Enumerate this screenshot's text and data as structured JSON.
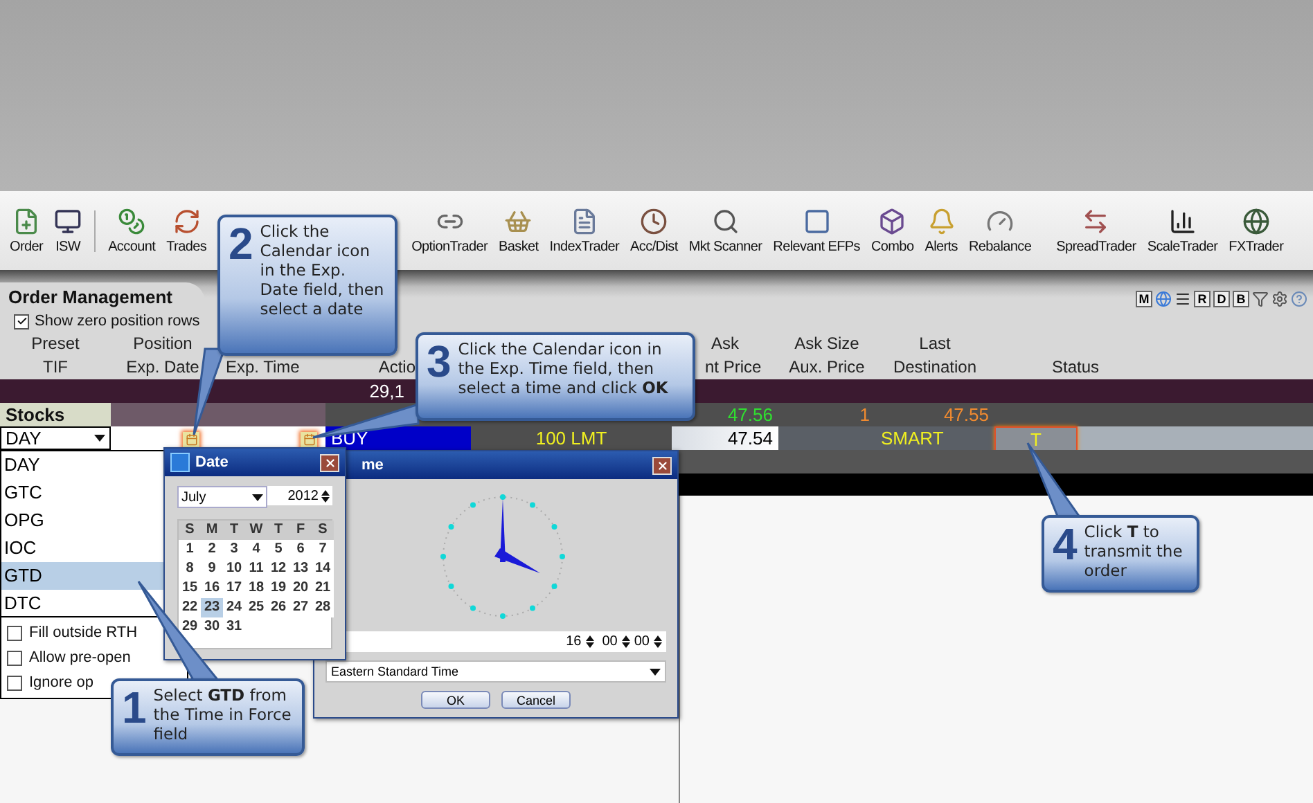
{
  "toolbar": {
    "items": [
      {
        "label": "Order"
      },
      {
        "label": "ISW"
      },
      {
        "label": "Account"
      },
      {
        "label": "Trades"
      },
      {
        "label": "OptionTrader"
      },
      {
        "label": "Basket"
      },
      {
        "label": "IndexTrader"
      },
      {
        "label": "Acc/Dist"
      },
      {
        "label": "Mkt Scanner"
      },
      {
        "label": "Relevant EFPs"
      },
      {
        "label": "Combo"
      },
      {
        "label": "Alerts"
      },
      {
        "label": "Rebalance"
      },
      {
        "label": "SpreadTrader"
      },
      {
        "label": "ScaleTrader"
      },
      {
        "label": "FXTrader"
      }
    ]
  },
  "panel": {
    "title": "Order Management",
    "view_buttons": [
      "M",
      "R",
      "D",
      "B"
    ],
    "show_zero": {
      "label": "Show zero position rows",
      "checked": true
    }
  },
  "table": {
    "header_top": [
      "Preset",
      "Position",
      "Ask",
      "Ask Size",
      "Last"
    ],
    "header_bottom": [
      "TIF",
      "Exp. Date",
      "Exp. Time",
      "Actio",
      "nt Price",
      "Aux. Price",
      "Destination",
      "Status"
    ],
    "summary_value": "29,1",
    "group": {
      "label": "Stocks",
      "ask": "47.56",
      "ask_size": "1",
      "last": "47.55"
    },
    "order": {
      "tif": "DAY",
      "action": "BUY",
      "quantity": "100 LMT",
      "limit_price": "47.54",
      "destination": "SMART",
      "status": "T"
    }
  },
  "tif_dropdown": {
    "options": [
      {
        "label": "DAY",
        "selected": false
      },
      {
        "label": "GTC",
        "selected": false
      },
      {
        "label": "OPG",
        "selected": false
      },
      {
        "label": "IOC",
        "selected": false
      },
      {
        "label": "GTD",
        "selected": true
      },
      {
        "label": "DTC",
        "selected": false
      }
    ],
    "checkboxes": [
      {
        "label": "Fill outside RTH",
        "checked": false
      },
      {
        "label": "Allow pre-open",
        "checked": false
      },
      {
        "label": "Ignore op",
        "checked": false
      }
    ]
  },
  "date_dialog": {
    "title": "Date",
    "month": "July",
    "year": "2012",
    "weekdays": [
      "S",
      "M",
      "T",
      "W",
      "T",
      "F",
      "S"
    ],
    "days": [
      {
        "day": "1",
        "selected": false
      },
      {
        "day": "2",
        "selected": false
      },
      {
        "day": "3",
        "selected": false
      },
      {
        "day": "4",
        "selected": false
      },
      {
        "day": "5",
        "selected": false
      },
      {
        "day": "6",
        "selected": false
      },
      {
        "day": "7",
        "selected": false
      },
      {
        "day": "8",
        "selected": false
      },
      {
        "day": "9",
        "selected": false
      },
      {
        "day": "10",
        "selected": false
      },
      {
        "day": "11",
        "selected": false
      },
      {
        "day": "12",
        "selected": false
      },
      {
        "day": "13",
        "selected": false
      },
      {
        "day": "14",
        "selected": false
      },
      {
        "day": "15",
        "selected": false
      },
      {
        "day": "16",
        "selected": false
      },
      {
        "day": "17",
        "selected": false
      },
      {
        "day": "18",
        "selected": false
      },
      {
        "day": "19",
        "selected": false
      },
      {
        "day": "20",
        "selected": false
      },
      {
        "day": "21",
        "selected": false
      },
      {
        "day": "22",
        "selected": false
      },
      {
        "day": "23",
        "selected": true
      },
      {
        "day": "24",
        "selected": false
      },
      {
        "day": "25",
        "selected": false
      },
      {
        "day": "26",
        "selected": false
      },
      {
        "day": "27",
        "selected": false
      },
      {
        "day": "28",
        "selected": false
      },
      {
        "day": "29",
        "selected": false
      },
      {
        "day": "30",
        "selected": false
      },
      {
        "day": "31",
        "selected": false
      }
    ]
  },
  "time_dialog": {
    "title": "me",
    "hours": "16",
    "minutes": "00",
    "seconds": "00",
    "timezone": "Eastern Standard Time",
    "buttons": [
      "OK",
      "Cancel"
    ]
  },
  "callouts": [
    {
      "number": "1",
      "text": "Select **GTD** from the Time in Force field"
    },
    {
      "number": "2",
      "text": "Click the Calendar icon in the Exp. Date field, then select a date"
    },
    {
      "number": "3",
      "text": "Click the Calendar icon in the Exp. Time field, then select a time and click **OK**"
    },
    {
      "number": "4",
      "text": "Click **T** to transmit the order"
    }
  ]
}
